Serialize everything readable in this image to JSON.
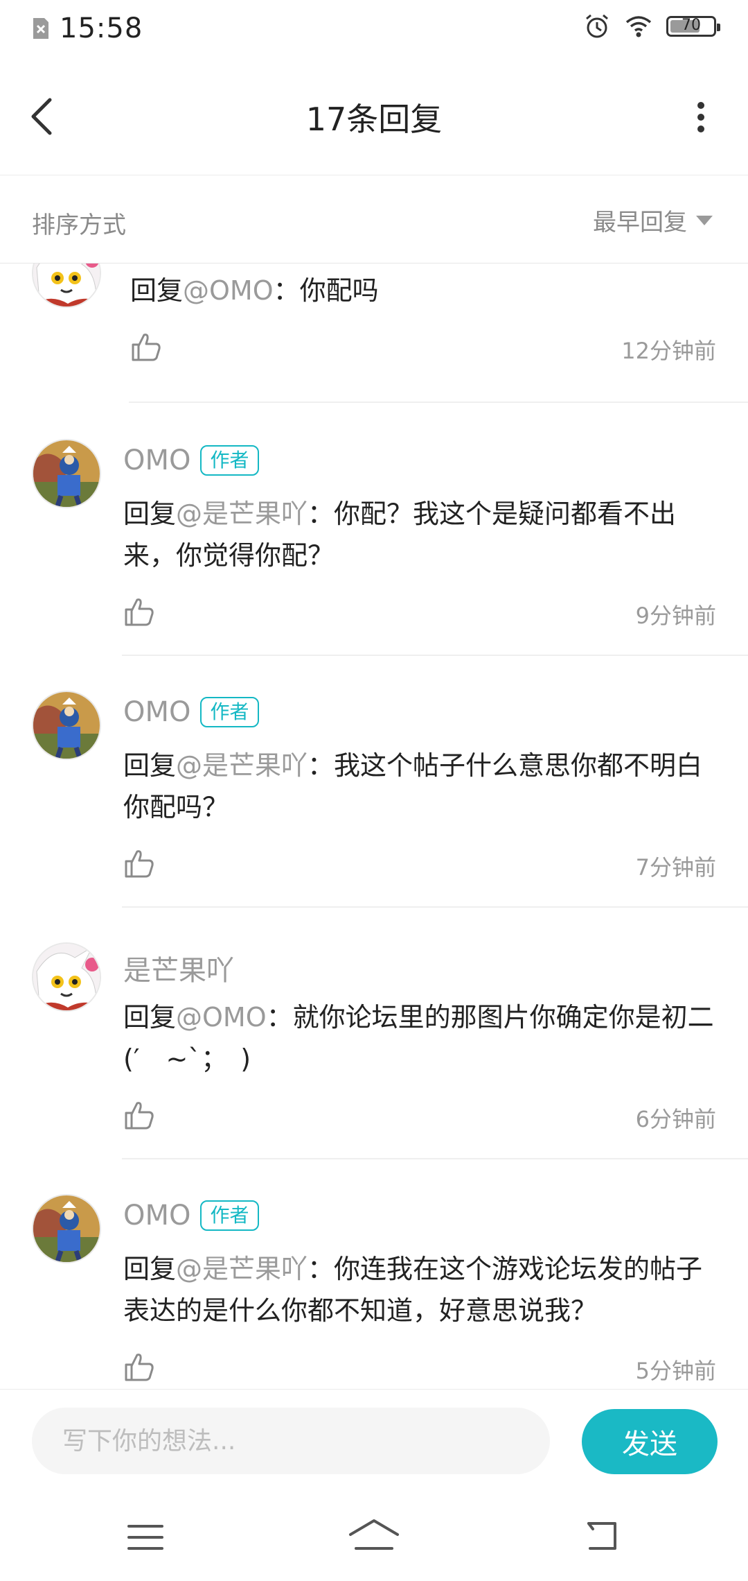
{
  "status_bar": {
    "time": "15:58",
    "battery": "70",
    "battery_level": 0.7
  },
  "header": {
    "title": "17条回复"
  },
  "sort": {
    "label": "排序方式",
    "value": "最早回复"
  },
  "replies": [
    {
      "author": "",
      "badge": "",
      "prefix": "回复",
      "mention": "@OMO",
      "sep": "：",
      "text": "你配吗",
      "time": "12分钟前",
      "avatar": "mango"
    },
    {
      "author": "OMO",
      "badge": "作者",
      "prefix": "回复",
      "mention": "@是芒果吖",
      "sep": "：",
      "text": "你配？我这个是疑问都看不出来，你觉得你配？",
      "time": "9分钟前",
      "avatar": "omo"
    },
    {
      "author": "OMO",
      "badge": "作者",
      "prefix": "回复",
      "mention": "@是芒果吖",
      "sep": "：",
      "text": "我这个帖子什么意思你都不明白你配吗？",
      "time": "7分钟前",
      "avatar": "omo"
    },
    {
      "author": "是芒果吖",
      "badge": "",
      "prefix": "回复",
      "mention": "@OMO",
      "sep": "：",
      "text": "就你论坛里的那图片你确定你是初二(′　~`；　)",
      "time": "6分钟前",
      "avatar": "mango"
    },
    {
      "author": "OMO",
      "badge": "作者",
      "prefix": "回复",
      "mention": "@是芒果吖",
      "sep": "：",
      "text": "你连我在这个游戏论坛发的帖子表达的是什么你都不知道，好意思说我？",
      "time": "5分钟前",
      "avatar": "omo"
    }
  ],
  "composer": {
    "placeholder": "写下你的想法...",
    "send_label": "发送"
  },
  "colors": {
    "accent": "#1ab9c5",
    "muted_text": "#9a9a9a"
  }
}
